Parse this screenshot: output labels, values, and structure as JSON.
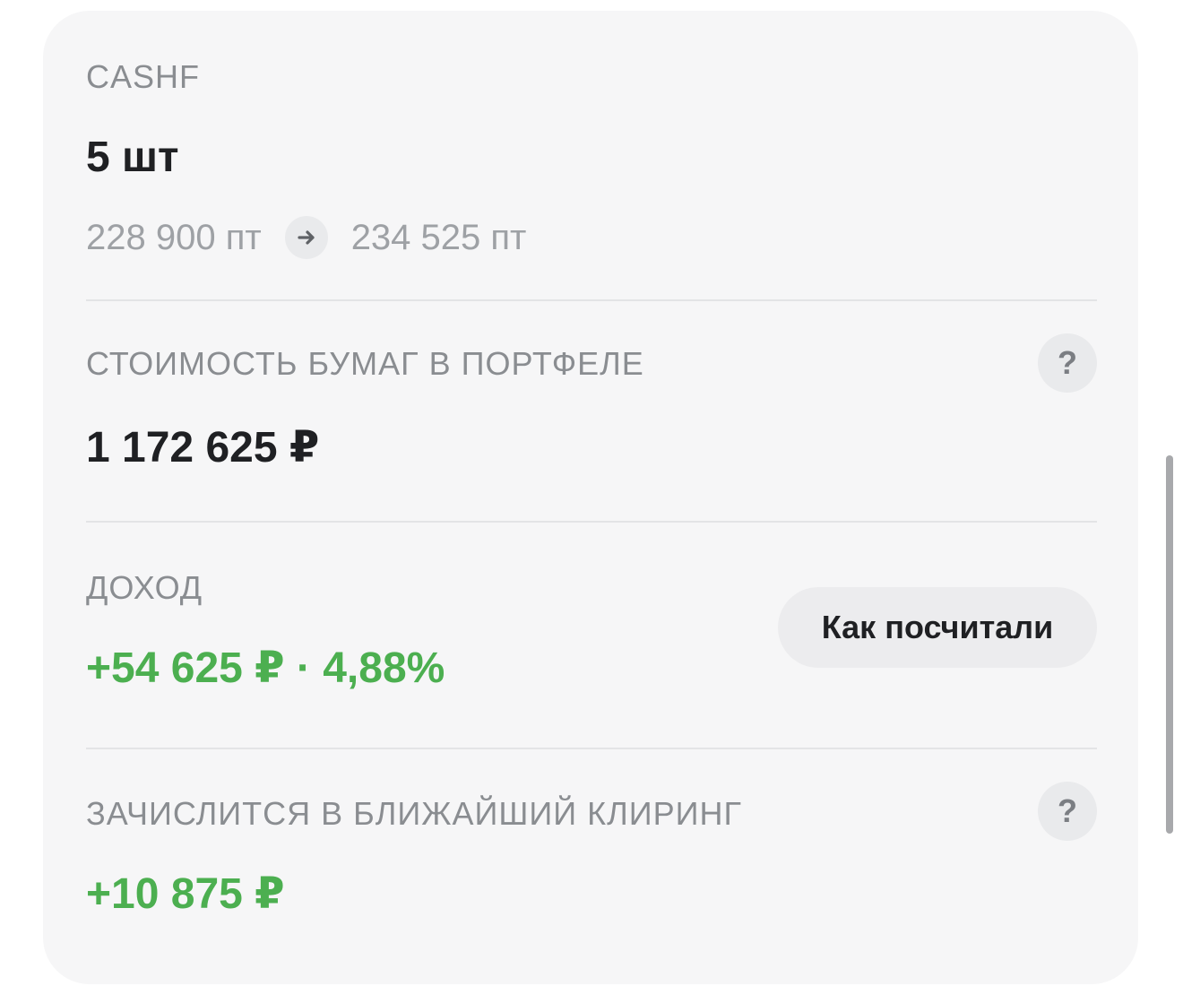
{
  "ticker": "CASHF",
  "quantity": "5 шт",
  "price_change": {
    "from": "228 900 пт",
    "to": "234 525 пт",
    "arrow_icon": "arrow-right-icon"
  },
  "portfolio_value": {
    "label": "СТОИМОСТЬ БУМАГ В ПОРТФЕЛЕ",
    "value": "1 172 625 ₽",
    "help_label": "?"
  },
  "income": {
    "label": "ДОХОД",
    "value": "+54 625 ₽ · 4,88%",
    "button_label": "Как посчитали"
  },
  "clearing": {
    "label": "ЗАЧИСЛИТСЯ В БЛИЖАЙШИЙ КЛИРИНГ",
    "value": "+10 875 ₽",
    "help_label": "?"
  },
  "colors": {
    "positive": "#4caf50",
    "card_bg": "#f6f6f7"
  }
}
